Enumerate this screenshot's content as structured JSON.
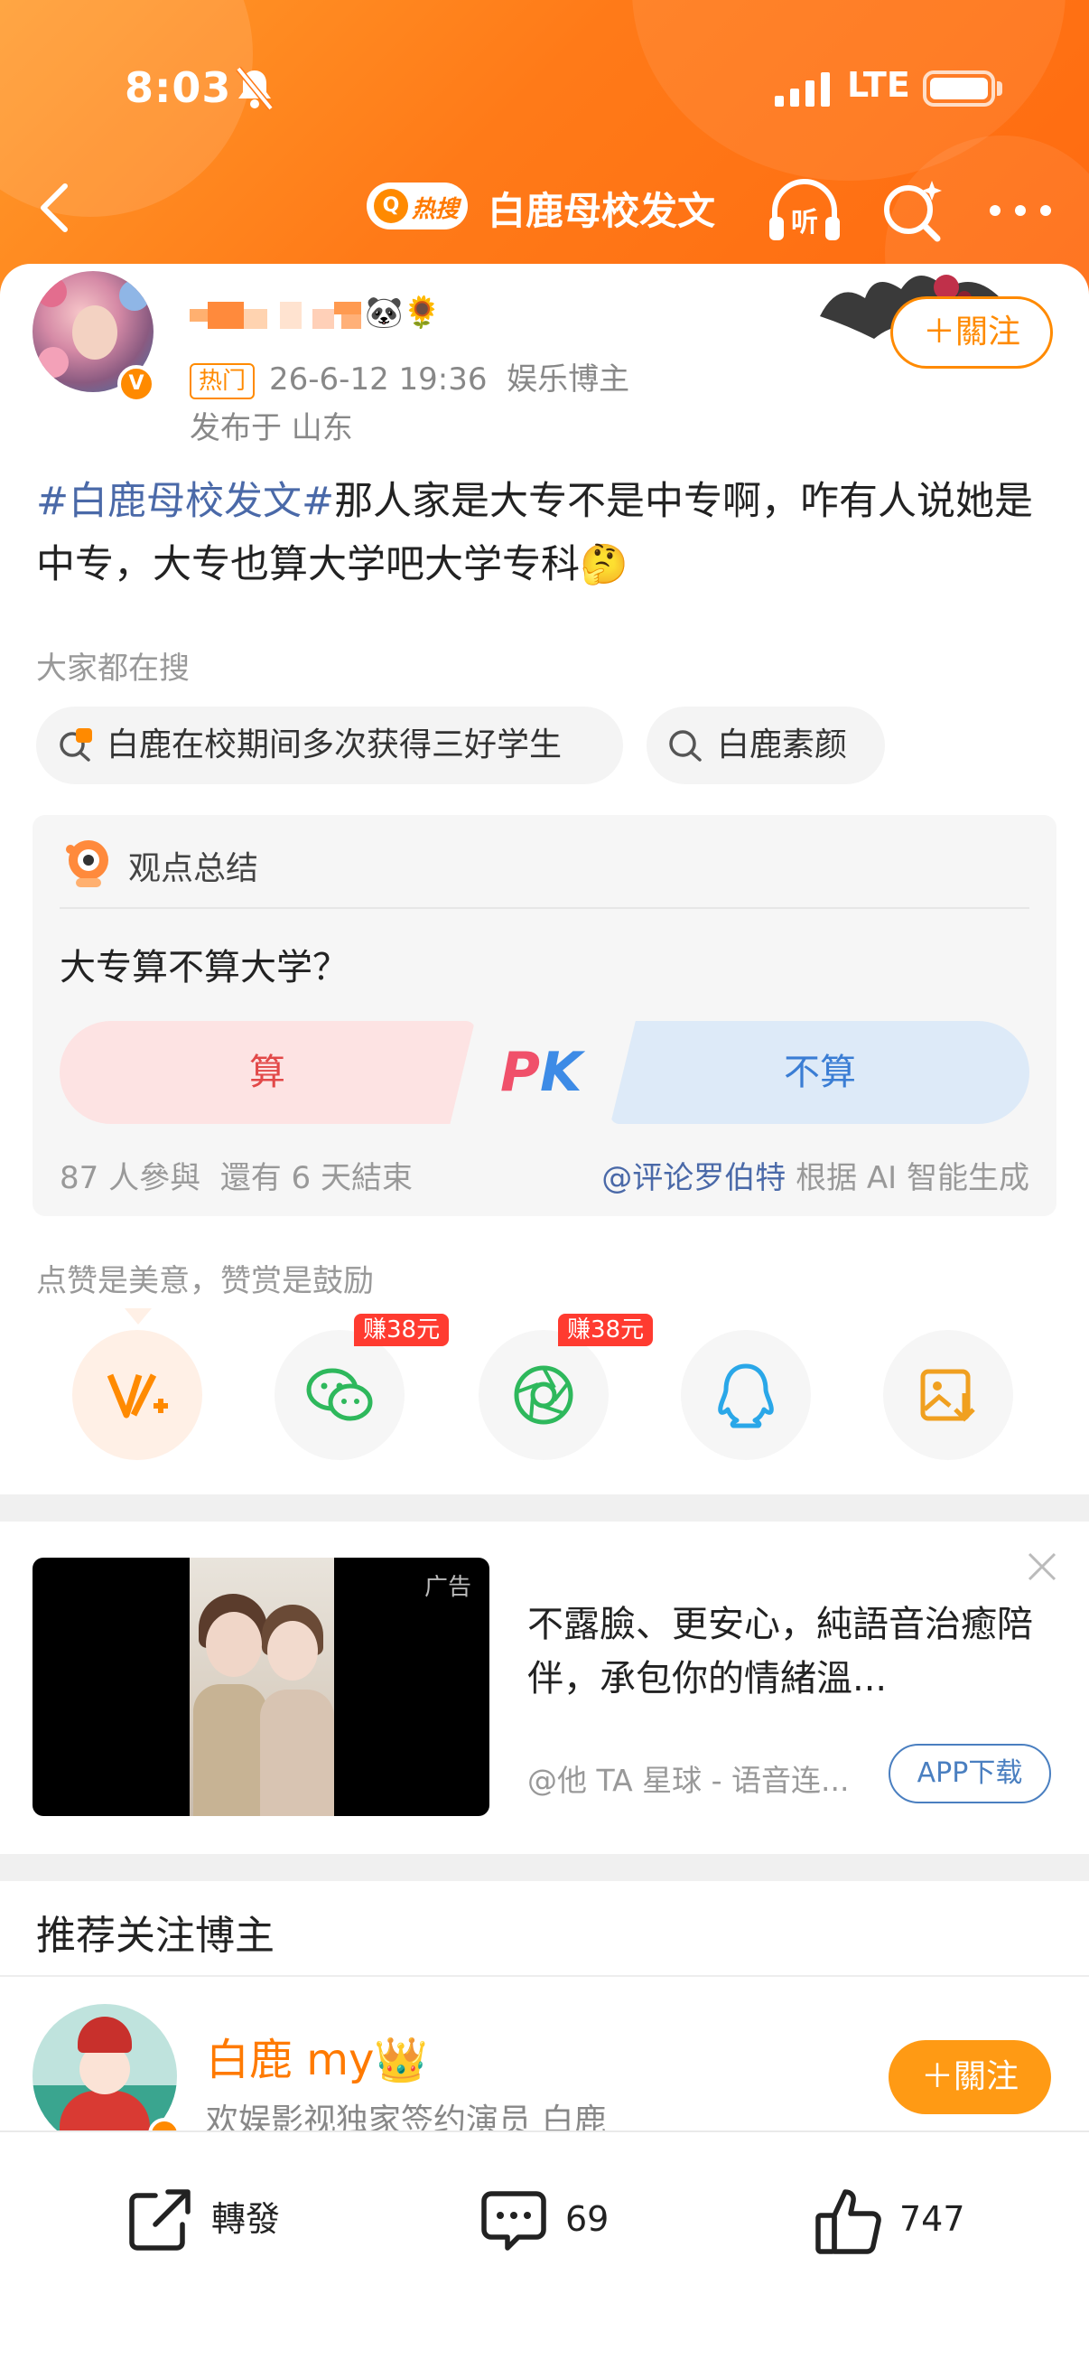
{
  "status_bar": {
    "time": "8:03",
    "network": "LTE"
  },
  "nav": {
    "hot_badge": "热搜",
    "title": "白鹿母校发文"
  },
  "post": {
    "author_name_note": "",
    "hot_label": "热门",
    "timestamp": "26-6-12 19:36",
    "category": "娱乐博主",
    "location": "发布于 山东",
    "follow_label": "＋關注",
    "hashtag": "#白鹿母校发文#",
    "body": "那人家是大专不是中专啊，咋有人说她是中专，大专也算大学吧大学专科🤔"
  },
  "search": {
    "title": "大家都在搜",
    "chips": [
      "白鹿在校期间多次获得三好学生",
      "白鹿素颜"
    ]
  },
  "opinion": {
    "title": "观点总结",
    "question": "大专算不算大学？",
    "option_yes": "算",
    "pk_p": "P",
    "pk_k": "K",
    "option_no": "不算",
    "participants": "87 人參與",
    "remaining": "還有 6 天結束",
    "attribution_at": "@评论罗伯特",
    "attribution_note": "根据 AI 智能生成"
  },
  "share": {
    "hint": "点赞是美意，赞赏是鼓励",
    "reward_1": "赚38元",
    "reward_2": "赚38元",
    "icons": [
      "reward-icon",
      "wechat-icon",
      "moments-icon",
      "qq-icon",
      "save-image-icon"
    ]
  },
  "ad": {
    "label": "广告",
    "text": "不露臉、更安心，純語音治癒陪伴，承包你的情緒溫...",
    "source": "@他 TA 星球 - 语音连...",
    "button": "APP下载"
  },
  "recommend": {
    "title": "推荐关注博主",
    "name": "白鹿 my👑",
    "desc": "欢娱影视独家签约演员 白鹿",
    "follow_label": "＋關注"
  },
  "bottom_bar": {
    "repost": "轉發",
    "comments": "69",
    "likes": "747"
  },
  "colors": {
    "accent": "#ff8a00",
    "link": "#4a69a8",
    "pk_red": "#e24848",
    "pk_blue": "#3a7dd4"
  }
}
